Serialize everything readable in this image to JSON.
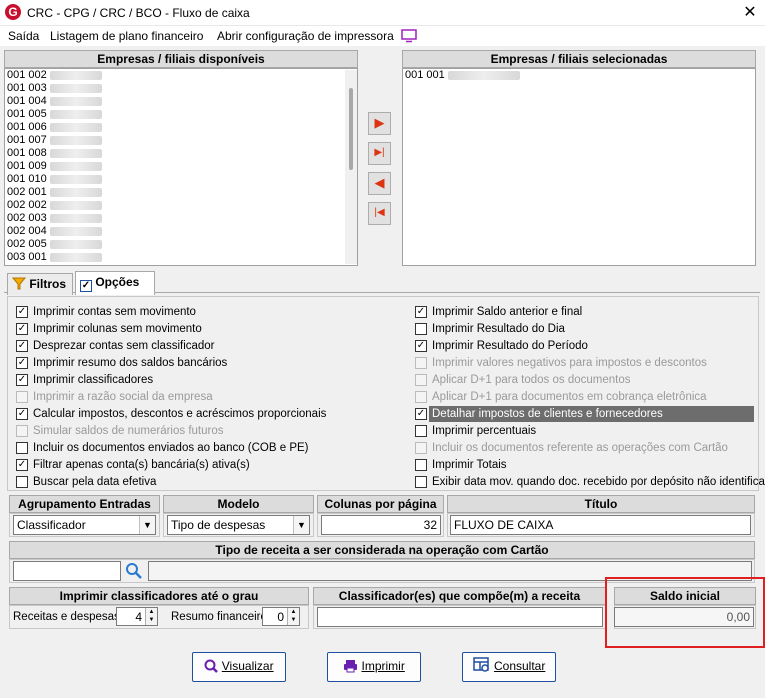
{
  "window": {
    "title": "CRC - CPG / CRC / BCO - Fluxo de caixa",
    "logo_letter": "G",
    "close": "✕"
  },
  "menu": [
    "Saída",
    "Listagem de plano financeiro",
    "Abrir configuração de impressora"
  ],
  "available": {
    "title": "Empresas / filiais disponíveis",
    "items": [
      "001 002",
      "001 003",
      "001 004",
      "001 005",
      "001 006",
      "001 007",
      "001 008",
      "001 009",
      "001 010",
      "002 001",
      "002 002",
      "002 003",
      "002 004",
      "002 005",
      "003 001"
    ]
  },
  "selected": {
    "title": "Empresas / filiais selecionadas",
    "items": [
      "001 001"
    ]
  },
  "tabs": {
    "filtros": "Filtros",
    "opcoes": "Opções"
  },
  "options_left": [
    {
      "label": "Imprimir contas sem movimento",
      "checked": true,
      "enabled": true
    },
    {
      "label": "Imprimir colunas sem movimento",
      "checked": true,
      "enabled": true
    },
    {
      "label": "Desprezar contas sem  classificador",
      "checked": true,
      "enabled": true
    },
    {
      "label": "Imprimir resumo dos saldos bancários",
      "checked": true,
      "enabled": true
    },
    {
      "label": "Imprimir classificadores",
      "checked": true,
      "enabled": true
    },
    {
      "label": "Imprimir a razão social da empresa",
      "checked": false,
      "enabled": false
    },
    {
      "label": "Calcular impostos, descontos e acréscimos proporcionais",
      "checked": true,
      "enabled": true
    },
    {
      "label": "Simular saldos de numerários futuros",
      "checked": false,
      "enabled": false
    },
    {
      "label": "Incluir os documentos enviados ao banco (COB e PE)",
      "checked": false,
      "enabled": true
    },
    {
      "label": "Filtrar apenas conta(s) bancária(s) ativa(s)",
      "checked": true,
      "enabled": true
    },
    {
      "label": "Buscar pela data efetiva",
      "checked": false,
      "enabled": true
    }
  ],
  "options_right": [
    {
      "label": "Imprimir Saldo anterior e final",
      "checked": true,
      "enabled": true
    },
    {
      "label": "Imprimir Resultado do Dia",
      "checked": false,
      "enabled": true
    },
    {
      "label": "Imprimir Resultado do Período",
      "checked": true,
      "enabled": true
    },
    {
      "label": "Imprimir valores negativos para impostos e descontos",
      "checked": false,
      "enabled": false
    },
    {
      "label": "Aplicar D+1 para todos os documentos",
      "checked": false,
      "enabled": false
    },
    {
      "label": "Aplicar D+1 para documentos em cobrança eletrônica",
      "checked": false,
      "enabled": false
    },
    {
      "label": "Detalhar impostos de clientes e fornecedores",
      "checked": true,
      "enabled": true,
      "highlight": true
    },
    {
      "label": "Imprimir percentuais",
      "checked": false,
      "enabled": true
    },
    {
      "label": "Incluir os documentos referente as operações com Cartão",
      "checked": false,
      "enabled": false
    },
    {
      "label": "Imprimir Totais",
      "checked": false,
      "enabled": true
    },
    {
      "label": "Exibir data mov. quando doc. recebido por depósito não identificado",
      "checked": false,
      "enabled": true
    }
  ],
  "agrupamento": {
    "title": "Agrupamento Entradas",
    "value": "Classificador"
  },
  "modelo": {
    "title": "Modelo",
    "value": "Tipo de despesas"
  },
  "colunas": {
    "title": "Colunas por página",
    "value": "32"
  },
  "titulo": {
    "title": "Título",
    "value": "FLUXO DE CAIXA"
  },
  "cartao": {
    "title": "Tipo de receita a ser considerada na operação com Cartão"
  },
  "grau": {
    "title": "Imprimir classificadores até o grau",
    "receitas_label": "Receitas e despesas",
    "receitas_value": "4",
    "resumo_label": "Resumo financeiro",
    "resumo_value": "0"
  },
  "classificador": {
    "title": "Classificador(es) que compõe(m) a receita"
  },
  "saldo": {
    "title": "Saldo inicial",
    "value": "0,00"
  },
  "buttons": {
    "visualizar": "Visualizar",
    "imprimir": "Imprimir",
    "consultar": "Consultar"
  },
  "colors": {
    "highlight_box": "#e02020",
    "selected_row": "#6d6d6d"
  }
}
